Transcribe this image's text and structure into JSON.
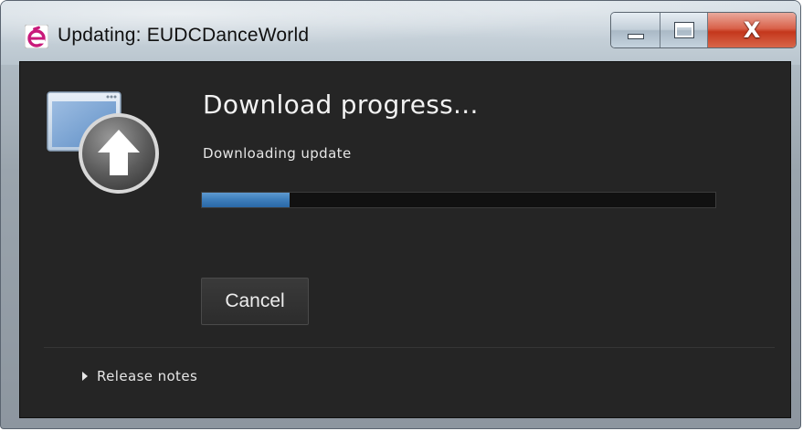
{
  "window": {
    "title": "Updating: EUDCDanceWorld",
    "app_icon": "eudc-app-icon",
    "controls": {
      "minimize_icon": "minimize-icon",
      "maximize_icon": "maximize-icon",
      "close_glyph": "X"
    }
  },
  "main": {
    "illustration_icon": "update-upload-icon",
    "heading": "Download progress...",
    "status": "Downloading update",
    "progress": {
      "fraction": 0.17,
      "fill_color": "#3f7fbc"
    },
    "cancel_label": "Cancel",
    "release_notes_label": "Release notes",
    "release_notes_icon": "triangle-right-icon"
  },
  "colors": {
    "client_background": "#252525",
    "accent": "#3f7fbc",
    "close_button": "#c4371c",
    "app_icon_accent": "#c8197a"
  }
}
